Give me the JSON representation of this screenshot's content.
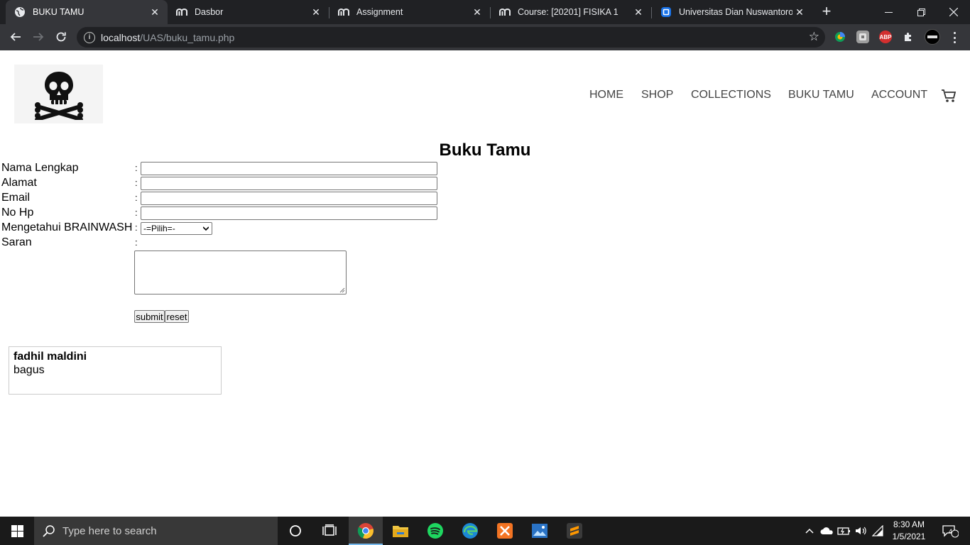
{
  "browser": {
    "tabs": [
      {
        "title": "BUKU TAMU",
        "icon": "globe-icon",
        "active": true
      },
      {
        "title": "Dasbor",
        "icon": "moodle-icon",
        "active": false
      },
      {
        "title": "Assignment",
        "icon": "moodle-icon",
        "active": false
      },
      {
        "title": "Course: [20201] FISIKA 1",
        "icon": "moodle-icon",
        "active": false
      },
      {
        "title": "Universitas Dian Nuswantoro |",
        "icon": "udinus-icon",
        "active": false
      }
    ],
    "new_tab": "+",
    "url_host": "localhost",
    "url_path": "/UAS/buku_tamu.php",
    "extensions": [
      "ABP"
    ]
  },
  "site": {
    "nav": [
      "HOME",
      "SHOP",
      "COLLECTIONS",
      "BUKU TAMU",
      "ACCOUNT"
    ]
  },
  "form": {
    "heading": "Buku Tamu",
    "colon": ":",
    "labels": {
      "nama": "Nama Lengkap",
      "alamat": "Alamat",
      "email": "Email",
      "nohp": "No Hp",
      "mengetahui": "Mengetahui BRAINWASH",
      "saran": "Saran"
    },
    "select_value": "-=Pilih=-",
    "submit_label": "submit",
    "reset_label": "reset"
  },
  "entries": [
    {
      "name": "fadhil maldini",
      "message": "bagus"
    }
  ],
  "taskbar": {
    "search_placeholder": "Type here to search",
    "time": "8:30 AM",
    "date": "1/5/2021",
    "notification_count": "4"
  }
}
